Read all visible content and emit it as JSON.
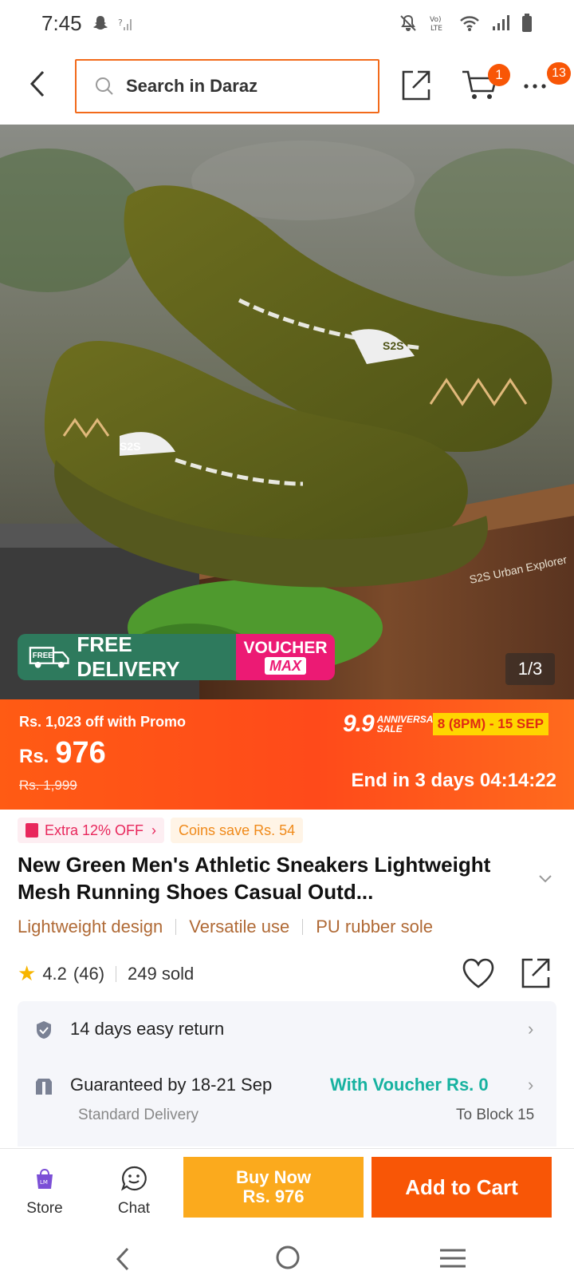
{
  "status_bar": {
    "time": "7:45"
  },
  "search": {
    "placeholder": "Search in Daraz"
  },
  "header": {
    "cart_count": "1",
    "more_count": "13"
  },
  "gallery": {
    "counter": "1/3",
    "product_label": "S2S Urban Explorer",
    "shoe_brand": "S2S",
    "promo_free_small": "FREE",
    "promo_free_delivery": "FREE DELIVERY",
    "promo_voucher": "VOUCHER",
    "promo_max": "MAX"
  },
  "price": {
    "promo_line": "Rs. 1,023 off with Promo",
    "currency": "Rs.",
    "amount": "976",
    "old_price": "Rs. 1,999",
    "sale_number": "9.9",
    "sale_label_1": "ANNIVERSARY",
    "sale_label_2": "SALE",
    "sale_dates": "8 (8PM) - 15 SEP",
    "countdown": "End in 3 days 04:14:22"
  },
  "tags": {
    "extra_off": "Extra 12% OFF",
    "coins": "Coins save Rs. 54"
  },
  "product": {
    "title": "New Green Men's Athletic Sneakers Lightweight Mesh Running Shoes Casual Outd...",
    "features": [
      "Lightweight design",
      "Versatile use",
      "PU rubber sole"
    ],
    "rating": "4.2",
    "reviews": "(46)",
    "sold": "249 sold"
  },
  "delivery": {
    "return_text": "14 days easy return",
    "guarantee_text": "Guaranteed by 18-21 Sep",
    "voucher_text": "With Voucher Rs. 0",
    "method": "Standard Delivery",
    "location": "To Block 15"
  },
  "bottom_bar": {
    "store_label": "Store",
    "chat_label": "Chat",
    "buy_now_label": "Buy Now",
    "buy_now_price": "Rs. 976",
    "add_to_cart_label": "Add to Cart"
  },
  "colors": {
    "accent": "#f85606",
    "buy_now": "#fbaa1d",
    "voucher_text": "#17b2a0",
    "feature_text": "#b06a36"
  }
}
